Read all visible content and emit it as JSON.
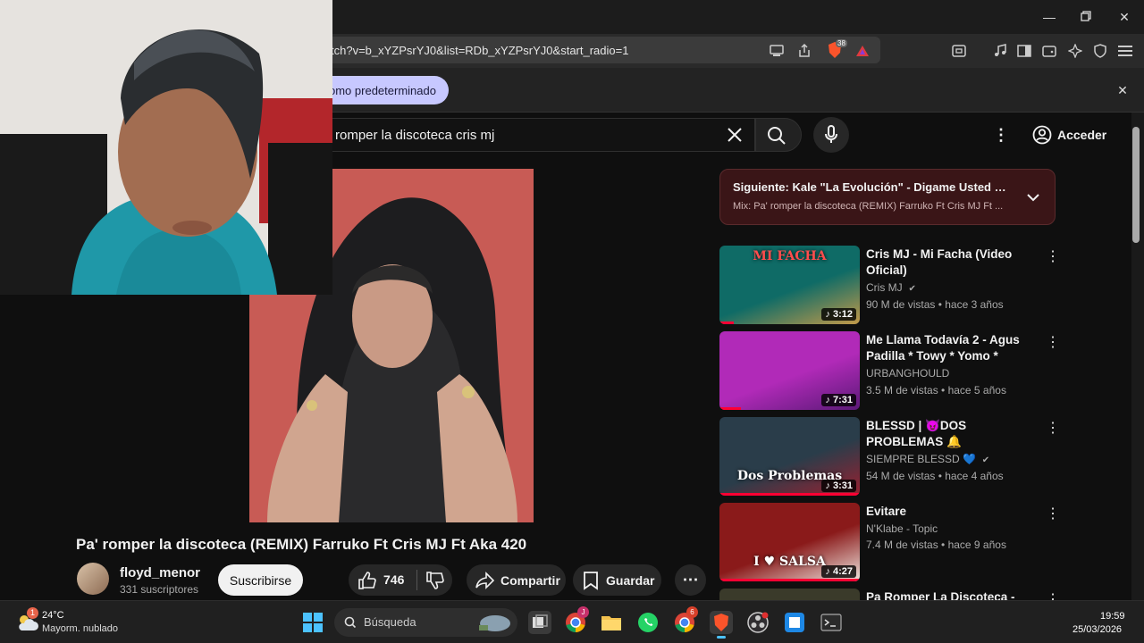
{
  "browser": {
    "url": "tch?v=b_xYZPsrYJ0&list=RDb_xYZPsrYJ0&start_radio=1",
    "shield_badge": "38",
    "infobar_button": "omo predeterminado"
  },
  "youtube": {
    "search_query": "romper la discoteca cris mj",
    "sign_in_label": "Acceder",
    "video": {
      "title": "Pa' romper la discoteca (REMIX) Farruko Ft Cris MJ Ft Aka 420",
      "channel": "floyd_menor",
      "subscribers": "331 suscriptores",
      "subscribe_label": "Suscribirse",
      "likes": "746",
      "share_label": "Compartir",
      "save_label": "Guardar"
    },
    "mix_card": {
      "next_title": "Siguiente: Kale \"La Evolución\" - Digame Usted \"Señ...",
      "mix_title": "Mix: Pa' romper la discoteca (REMIX) Farruko Ft Cris MJ Ft ..."
    },
    "recommendations": [
      {
        "title": "Cris MJ - Mi Facha (Video Oficial)",
        "channel": "Cris MJ",
        "verified": true,
        "meta": "90 M de vistas • hace 3 años",
        "duration": "3:12",
        "progress": 0.1,
        "thumb_text": "MI FACHA",
        "colors": [
          "#0f6b66",
          "#c39a4a"
        ]
      },
      {
        "title": "Me Llama Todavía 2 -  Agus Padilla  * Towy * Yomo * Gotay...",
        "channel": "URBANGHOULD",
        "verified": false,
        "meta": "3.5 M de vistas • hace 5 años",
        "duration": "7:31",
        "progress": 0.15,
        "thumb_text": "",
        "colors": [
          "#b12ab8",
          "#5b1a78"
        ]
      },
      {
        "title": "BLESSD | 😈DOS PROBLEMAS 🔔",
        "channel": "SIEMPRE BLESSD 💙",
        "verified": true,
        "meta": "54 M de vistas • hace 4 años",
        "duration": "3:31",
        "progress": 1.0,
        "thumb_text": "Dos Problemas",
        "colors": [
          "#2a3d4a",
          "#9a2030"
        ]
      },
      {
        "title": "Evitare",
        "channel": "N'Klabe - Topic",
        "verified": false,
        "meta": "7.4 M de vistas • hace 9 años",
        "duration": "4:27",
        "progress": 1.0,
        "thumb_text": "I ♥ SALSA",
        "colors": [
          "#8a1a1a",
          "#f0e6e0"
        ]
      },
      {
        "title": "Pa Romper La Discoteca -",
        "channel": "",
        "verified": false,
        "meta": "",
        "duration": "",
        "progress": 0,
        "thumb_text": "",
        "colors": [
          "#3a3a2a",
          "#222"
        ]
      }
    ]
  },
  "taskbar": {
    "weather_temp": "24°C",
    "weather_desc": "Mayorm. nublado",
    "weather_badge": "1",
    "search_label": "Búsqueda",
    "time": "19:59",
    "date": "25/03/2026",
    "chrome_badge": "J",
    "chrome2_badge": "6"
  },
  "colors": {
    "accent_red": "#ff0033",
    "infobar_pill": "#c7c8ff",
    "brave_orange": "#fb542b"
  }
}
